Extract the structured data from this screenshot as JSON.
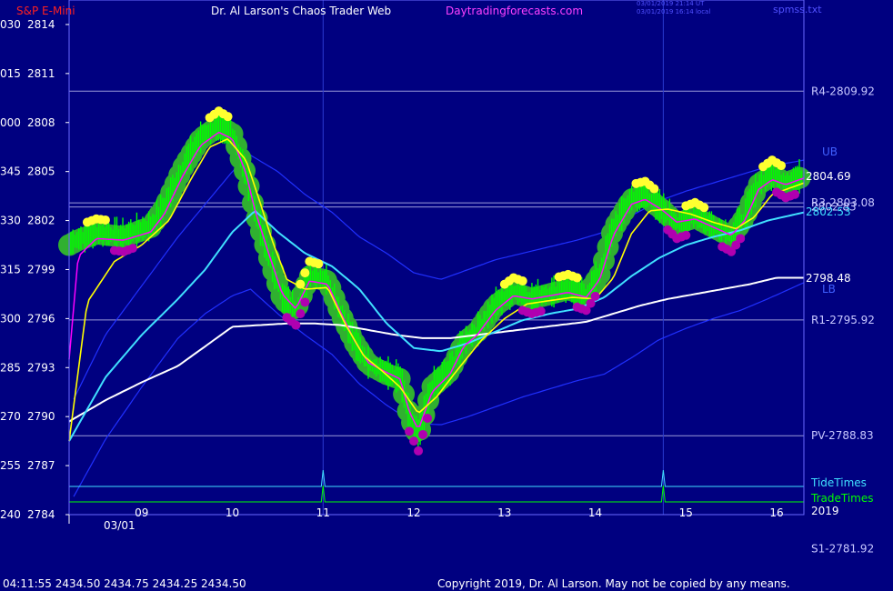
{
  "header": {
    "symbol": "S&P E-Mini",
    "title": "Dr. Al Larson's Chaos Trader Web",
    "site": "Daytradingforecasts.com",
    "stamp1": "03/01/2019 21:14 UT",
    "stamp2": "03/01/2019 16:14 local",
    "file": "spmss.txt"
  },
  "footer": {
    "quote": "04:11:55  2434.50  2434.75  2434.25  2434.50",
    "copyright": "Copyright 2019, Dr. Al Larson. May not be copied by any means."
  },
  "colors": {
    "background": "#000080",
    "frame": "#6a6aff",
    "level_line": "#9a9ad8",
    "price": "#00ff00",
    "halo": "#30b030",
    "yellow_line": "#ffff00",
    "magenta_line": "#ff00ff",
    "cyan_line": "#40e0ff",
    "white_line": "#ffffff",
    "blue_line": "#2030ff",
    "tide": "#40e0ff",
    "trade": "#00ff00"
  },
  "chart_data": {
    "type": "line",
    "ylim": [
      2784,
      2815.5
    ],
    "xlim": [
      8.0,
      16.1
    ],
    "y_ticks": [
      {
        "value": 2814,
        "left": "030",
        "right": "2814"
      },
      {
        "value": 2811,
        "left": "015",
        "right": "2811"
      },
      {
        "value": 2808,
        "left": "000",
        "right": "2808"
      },
      {
        "value": 2805,
        "left": "345",
        "right": "2805"
      },
      {
        "value": 2802,
        "left": "330",
        "right": "2802"
      },
      {
        "value": 2799,
        "left": "315",
        "right": "2799"
      },
      {
        "value": 2796,
        "left": "300",
        "right": "2796"
      },
      {
        "value": 2793,
        "left": "285",
        "right": "2793"
      },
      {
        "value": 2790,
        "left": "270",
        "right": "2790"
      },
      {
        "value": 2787,
        "left": "255",
        "right": "2787"
      },
      {
        "value": 2784,
        "left": "240",
        "right": "2784"
      }
    ],
    "x_ticks": [
      {
        "value": 8.8,
        "label": "09"
      },
      {
        "value": 9.8,
        "label": "10"
      },
      {
        "value": 10.8,
        "label": "11"
      },
      {
        "value": 11.8,
        "label": "12"
      },
      {
        "value": 12.8,
        "label": "13"
      },
      {
        "value": 13.8,
        "label": "14"
      },
      {
        "value": 14.8,
        "label": "15"
      },
      {
        "value": 15.8,
        "label": "16"
      }
    ],
    "date_label": "03/01",
    "year_label": "2019",
    "levels": [
      {
        "label": "R4-2809.92",
        "value": 2809.92,
        "show_line": true
      },
      {
        "label": "R3-2803.08",
        "value": 2803.08,
        "show_line": true
      },
      {
        "label": "2802.83",
        "value": 2802.83,
        "show_line": true
      },
      {
        "label": "R1-2795.92",
        "value": 2795.92,
        "show_line": true
      },
      {
        "label": "PV-2788.83",
        "value": 2788.83,
        "show_line": true
      },
      {
        "label": "S1-2781.92",
        "value": 2781.92,
        "show_line": false
      }
    ],
    "band_labels": [
      {
        "label": "UB",
        "value": 2806.2
      },
      {
        "label": "LB",
        "value": 2797.8
      }
    ],
    "last_values": [
      {
        "label": "2804.69",
        "value": 2804.69,
        "color": "#ffffff"
      },
      {
        "label": "2802.53",
        "value": 2802.53,
        "color": "#40e0ff"
      },
      {
        "label": "2798.48",
        "value": 2798.48,
        "color": "#ffffff"
      }
    ],
    "timing_lines": [
      {
        "name": "TideTimes",
        "spikes": [
          10.8,
          14.55
        ]
      },
      {
        "name": "TradeTimes",
        "spikes": [
          10.8,
          14.55
        ]
      }
    ],
    "series": [
      {
        "name": "price",
        "x": [
          8.0,
          8.1,
          8.3,
          8.6,
          8.9,
          9.05,
          9.25,
          9.45,
          9.65,
          9.8,
          9.95,
          10.05,
          10.2,
          10.35,
          10.5,
          10.65,
          10.85,
          11.0,
          11.15,
          11.3,
          11.5,
          11.65,
          11.75,
          11.85,
          12.0,
          12.2,
          12.35,
          12.5,
          12.7,
          12.9,
          13.1,
          13.3,
          13.5,
          13.7,
          13.85,
          14.0,
          14.2,
          14.35,
          14.55,
          14.7,
          14.9,
          15.1,
          15.3,
          15.45,
          15.6,
          15.75,
          15.9,
          16.1
        ],
        "y": [
          2800.5,
          2800.8,
          2801.2,
          2801.0,
          2801.6,
          2802.8,
          2805.2,
          2807.0,
          2807.8,
          2807.3,
          2804.8,
          2802.5,
          2799.8,
          2797.2,
          2796.5,
          2798.6,
          2798.3,
          2796.2,
          2794.5,
          2793.2,
          2792.6,
          2792.3,
          2790.0,
          2788.8,
          2791.8,
          2792.8,
          2794.5,
          2795.2,
          2796.8,
          2797.6,
          2797.2,
          2797.5,
          2797.8,
          2797.4,
          2798.7,
          2801.5,
          2803.3,
          2803.5,
          2802.6,
          2801.8,
          2802.2,
          2801.6,
          2801.0,
          2802.2,
          2804.2,
          2804.8,
          2804.3,
          2804.7
        ]
      },
      {
        "name": "yellow",
        "x": [
          8.0,
          8.2,
          8.5,
          8.8,
          9.1,
          9.35,
          9.55,
          9.75,
          9.95,
          10.1,
          10.25,
          10.4,
          10.6,
          10.85,
          11.05,
          11.25,
          11.45,
          11.65,
          11.85,
          12.05,
          12.3,
          12.55,
          12.8,
          13.05,
          13.3,
          13.55,
          13.8,
          14.0,
          14.2,
          14.4,
          14.6,
          14.85,
          15.1,
          15.35,
          15.55,
          15.75,
          15.95,
          16.1
        ],
        "y": [
          2788.5,
          2797.0,
          2799.5,
          2800.5,
          2802.0,
          2804.6,
          2806.5,
          2807.0,
          2805.7,
          2803.2,
          2800.6,
          2798.4,
          2797.8,
          2797.9,
          2795.6,
          2793.7,
          2792.8,
          2791.8,
          2790.2,
          2791.2,
          2793.0,
          2794.7,
          2796.0,
          2796.9,
          2797.1,
          2797.3,
          2797.2,
          2798.5,
          2801.2,
          2802.6,
          2802.7,
          2802.4,
          2801.9,
          2801.5,
          2802.2,
          2803.6,
          2804.0,
          2804.3
        ]
      },
      {
        "name": "magenta",
        "x": [
          8.0,
          8.1,
          8.3,
          8.6,
          8.9,
          9.05,
          9.25,
          9.45,
          9.65,
          9.8,
          9.95,
          10.05,
          10.2,
          10.35,
          10.5,
          10.65,
          10.85,
          11.0,
          11.15,
          11.3,
          11.5,
          11.65,
          11.75,
          11.85,
          12.0,
          12.2,
          12.35,
          12.5,
          12.7,
          12.9,
          13.1,
          13.3,
          13.5,
          13.7,
          13.85,
          14.0,
          14.2,
          14.35,
          14.55,
          14.7,
          14.9,
          15.1,
          15.3,
          15.45,
          15.6,
          15.75,
          15.9,
          16.1
        ],
        "y": [
          2793.5,
          2799.8,
          2800.9,
          2800.8,
          2801.3,
          2802.4,
          2804.7,
          2806.6,
          2807.4,
          2807.0,
          2804.9,
          2802.6,
          2800.0,
          2797.5,
          2796.6,
          2798.3,
          2798.1,
          2796.3,
          2794.6,
          2793.3,
          2792.7,
          2792.3,
          2790.3,
          2789.2,
          2791.5,
          2792.6,
          2794.3,
          2795.0,
          2796.5,
          2797.4,
          2797.2,
          2797.4,
          2797.6,
          2797.3,
          2798.4,
          2801.1,
          2803.0,
          2803.3,
          2802.6,
          2801.9,
          2802.1,
          2801.6,
          2801.1,
          2802.0,
          2803.9,
          2804.5,
          2804.2,
          2804.6
        ]
      },
      {
        "name": "cyan",
        "x": [
          8.0,
          8.4,
          8.8,
          9.2,
          9.5,
          9.8,
          10.05,
          10.3,
          10.6,
          10.9,
          11.2,
          11.5,
          11.8,
          12.1,
          12.4,
          12.7,
          13.0,
          13.3,
          13.6,
          13.9,
          14.2,
          14.5,
          14.8,
          15.1,
          15.4,
          15.7,
          16.1
        ],
        "y": [
          2788.5,
          2792.4,
          2795.0,
          2797.2,
          2799.0,
          2801.3,
          2802.6,
          2801.3,
          2800.0,
          2799.2,
          2797.8,
          2795.7,
          2794.2,
          2794.0,
          2794.5,
          2795.2,
          2795.9,
          2796.3,
          2796.6,
          2797.3,
          2798.6,
          2799.7,
          2800.5,
          2801.0,
          2801.4,
          2802.0,
          2802.5
        ]
      },
      {
        "name": "white",
        "x": [
          8.0,
          8.4,
          8.8,
          9.2,
          9.5,
          9.8,
          10.1,
          10.4,
          10.7,
          11.0,
          11.3,
          11.6,
          11.9,
          12.2,
          12.5,
          12.8,
          13.1,
          13.4,
          13.7,
          14.0,
          14.3,
          14.6,
          14.9,
          15.2,
          15.5,
          15.8,
          16.1
        ],
        "y": [
          2789.7,
          2791.0,
          2792.1,
          2793.1,
          2794.3,
          2795.5,
          2795.6,
          2795.7,
          2795.7,
          2795.6,
          2795.3,
          2795.0,
          2794.8,
          2794.8,
          2795.0,
          2795.2,
          2795.4,
          2795.6,
          2795.8,
          2796.3,
          2796.8,
          2797.2,
          2797.5,
          2797.8,
          2798.1,
          2798.5,
          2798.5
        ]
      },
      {
        "name": "upper-band",
        "x": [
          8.0,
          8.4,
          8.8,
          9.2,
          9.5,
          9.8,
          10.0,
          10.3,
          10.6,
          10.9,
          11.2,
          11.5,
          11.8,
          12.1,
          12.4,
          12.7,
          13.0,
          13.3,
          13.6,
          13.9,
          14.2,
          14.5,
          14.8,
          15.1,
          15.4,
          15.7,
          16.1
        ],
        "y": [
          2790.5,
          2795.0,
          2798.0,
          2801.0,
          2803.0,
          2805.0,
          2806.0,
          2805.0,
          2803.6,
          2802.5,
          2801.0,
          2800.0,
          2798.8,
          2798.4,
          2799.0,
          2799.6,
          2800.0,
          2800.4,
          2800.8,
          2801.3,
          2802.3,
          2803.2,
          2803.8,
          2804.3,
          2804.8,
          2805.3,
          2805.7
        ]
      },
      {
        "name": "lower-band",
        "x": [
          8.0,
          8.4,
          8.8,
          9.2,
          9.5,
          9.8,
          10.0,
          10.3,
          10.6,
          10.9,
          11.2,
          11.5,
          11.8,
          12.1,
          12.4,
          12.7,
          13.0,
          13.3,
          13.6,
          13.9,
          14.2,
          14.5,
          14.8,
          15.1,
          15.4,
          15.7,
          16.1
        ],
        "y": [
          2784.6,
          2788.6,
          2791.8,
          2794.8,
          2796.3,
          2797.4,
          2797.8,
          2796.3,
          2795.0,
          2793.8,
          2792.0,
          2790.7,
          2789.6,
          2789.5,
          2790.0,
          2790.6,
          2791.2,
          2791.7,
          2792.2,
          2792.6,
          2793.6,
          2794.7,
          2795.4,
          2796.0,
          2796.5,
          2797.2,
          2798.2
        ]
      }
    ]
  }
}
